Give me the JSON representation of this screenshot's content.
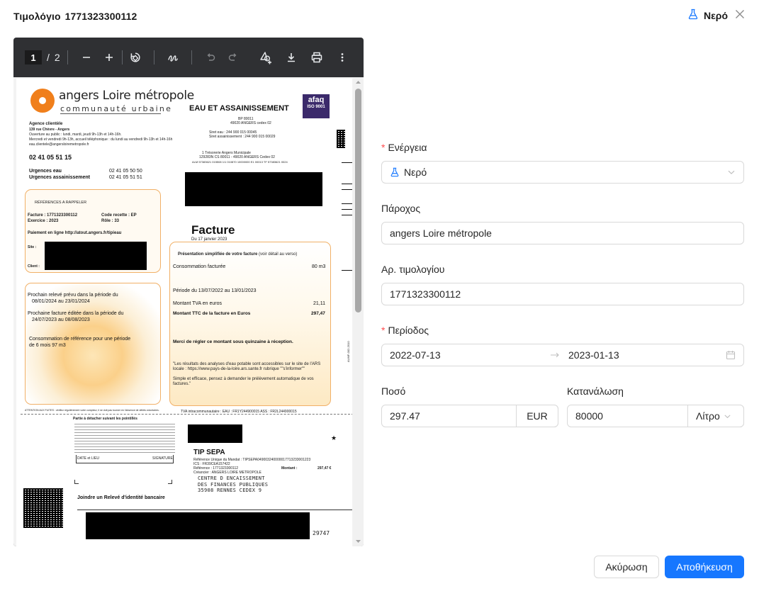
{
  "header": {
    "title_prefix": "Τιμολόγιο",
    "invoice_number": "1771323300112",
    "energy_label": "Νερό",
    "energy_icon": "flask-icon",
    "close_icon": "close-icon"
  },
  "pdf_toolbar": {
    "current_page": "1",
    "separator": "/",
    "total_pages": "2"
  },
  "invoice_document": {
    "brand": "angers Loire métropole",
    "brand_sub": "communauté urbaine",
    "service_title": "EAU ET ASSAINISSEMENT",
    "certification": "afaq",
    "certification_sub": "ISO 9001",
    "agency_title": "Agence clientèle",
    "agency_address": "139 rue Chèvre - Angers",
    "agency_hours_1": "Ouverture au public : lundi, mardi, jeudi 9h-13h et 14h-16h.",
    "agency_hours_2": "Mercredi et vendredi 9h-13h, accueil téléphonique : du lundi au vendredi 9h-13h et 14h-16h",
    "agency_email": "eau.clientele@angersloiremetropole.fr",
    "agency_phone": "02 41 05 51 15",
    "bp": "BP 80011",
    "bp_city": "49020 ANGERS cedex 02",
    "siret_eau": "Siret eau : 244 900 015 00045",
    "siret_assain": "Siret assainissement : 244 900 015 00029",
    "tresorerie_1": "1        Trésorerie Angers Municipale",
    "tresorerie_2": "129283N   CS 80011 - 49020 ANGERS Cedex 02",
    "alm": "ALM 57383621 015508 1/1 010870 10000000 E1 00013 TF 57383621 0024",
    "urgences_eau_label": "Urgences eau",
    "urgences_eau": "02 41 05 50 50",
    "urgences_assain_label": "Urgences assainissement",
    "urgences_assain": "02 41 05 51 51",
    "references_title": "RÉFÉRENCES A RAPPELER",
    "ref_facture": "Facture  : 1771323300112",
    "ref_code": "Code recette  : EP",
    "ref_exercice": "Exercice  : 2023",
    "ref_role": "Rôle : 33",
    "ref_paiement": "Paiement en ligne http://atout.angers.fr/tipieau",
    "ref_site": "Site :",
    "ref_client": "Client :",
    "releve_1": "Prochain relevé prévu dans la période du",
    "releve_2": "08/01/2024    au    23/01/2024",
    "facture_edit_1": "Prochaine facture éditée dans la période du",
    "facture_edit_2": "24/07/2023    au    08/08/2023",
    "conso_ref_1": "Consommation de référence pour une période",
    "conso_ref_2": "de 6 mois 97  m3",
    "facture_heading": "Facture",
    "facture_date": "Du 17 janvier 2023",
    "pres_title": "Présentation simplifiée de votre facture",
    "pres_title_suffix": " (voir détail au verso)",
    "conso_label": "Consommation facturée",
    "conso_value": "80 m3",
    "periode_line": "Période du   13/07/2022 au 13/01/2023",
    "tva_label": "Montant TVA en euros",
    "tva_value": "21,11",
    "ttc_label": "Montant TTC de la facture en Euros",
    "ttc_value": "297,47",
    "merci": "Merci de régler ce montant sous quinzaine à réception.",
    "ars_text": "\"Les résultats des analyses d'eau potable sont accessibles sur le site de l'ARS locale : https://www.pays-de-la-loire.ars.sante.fr rubrique \"\"s'informer\"\"",
    "prelev_text": "Simple et efficace, pensez à demander le prélèvement automatique de vos factures.\"",
    "attention": "ATTENTION AUX FUITES : vérifiez régulièrement votre compteur, il ne doit pas tourner en l'absence de débits volontaires.",
    "tva_intra": "TVA intracommunautaire :      EAU : FR1Y244900015   ASS : FR2L244900015",
    "detach": "Partie à détacher suivant les pointillés",
    "date_lieu": "DATE et LIEU",
    "signature": "SIGNATURE",
    "tip_heading": "TIP SEPA",
    "rum": "Référence Unique du Mandat : TIPSEPA049003240000017713233001223",
    "ics": "ICS : FR39CEA157422",
    "reference": "Référence : 1771323300112",
    "montant_label": "Montant :",
    "montant_value": "297,47 €",
    "creancier": "Créancier : ANGERS LOIRE METROPOLE",
    "centre_1": "CENTRE D ENCAISSEMENT",
    "centre_2": "DES FINANCES PUBLIQUES",
    "centre_3": "35908 RENNES CEDEX 9",
    "rib": "Joindre un Relevé d'identité bancaire",
    "bottom_number": "29747",
    "side_code": "AUMF-002-2010",
    "star": "★"
  },
  "form": {
    "energy": {
      "label": "Ενέργεια",
      "required": true,
      "value": "Νερό",
      "icon": "flask-icon"
    },
    "provider": {
      "label": "Πάροχος",
      "value": "angers Loire métropole"
    },
    "invoice_no": {
      "label": "Αρ. τιμολογίου",
      "value": "1771323300112"
    },
    "period": {
      "label": "Περίοδος",
      "required": true,
      "start": "2022-07-13",
      "end": "2023-01-13",
      "icon": "calendar-icon"
    },
    "amount": {
      "label": "Ποσό",
      "value": "297.47",
      "currency": "EUR"
    },
    "consumption": {
      "label": "Κατανάλωση",
      "value": "80000",
      "unit": "Λίτρο"
    }
  },
  "footer": {
    "cancel_label": "Ακύρωση",
    "save_label": "Αποθήκευση"
  },
  "colors": {
    "primary": "#1677ff",
    "required": "#ff4d4f",
    "pdf_toolbar": "#2f3033",
    "brand_orange": "#f07f1b"
  }
}
